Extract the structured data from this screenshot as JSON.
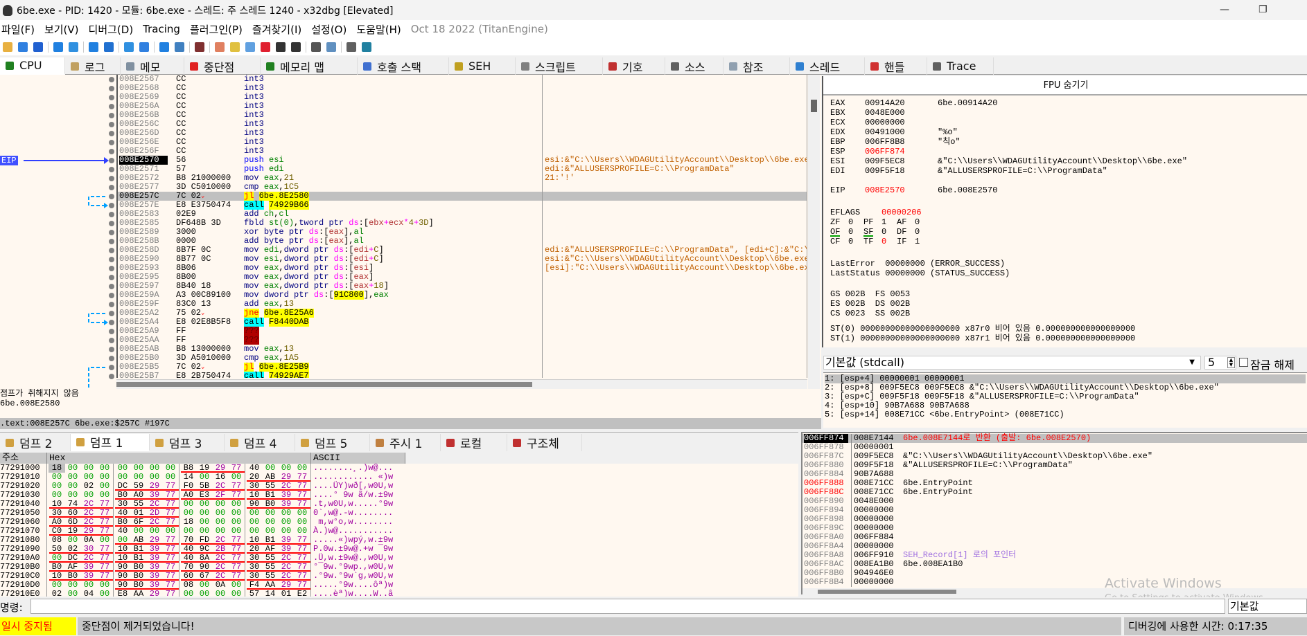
{
  "window": {
    "title": "6be.exe - PID: 1420 - 모듈: 6be.exe - 스레드: 주 스레드 1240 - x32dbg [Elevated]",
    "minimize": "—",
    "restore": "❐"
  },
  "menu": [
    "파일(F)",
    "보기(V)",
    "디버그(D)",
    "Tracing",
    "플러그인(P)",
    "즐겨찾기(I)",
    "설정(O)",
    "도움말(H)"
  ],
  "version": "Oct 18 2022 (TitanEngine)",
  "toolbar": [
    {
      "icon": "open-icon",
      "color": "#e8b040"
    },
    {
      "icon": "restart-icon",
      "color": "#3080e0"
    },
    {
      "icon": "stop-icon",
      "color": "#2060d0"
    },
    "sep",
    {
      "icon": "run-icon",
      "color": "#2080e0"
    },
    {
      "icon": "pause-icon",
      "color": "#3090e0"
    },
    "sep",
    {
      "icon": "step-into-icon",
      "color": "#2080e0"
    },
    {
      "icon": "step-over-icon",
      "color": "#2070d0"
    },
    "sep",
    {
      "icon": "trace-into-icon",
      "color": "#3090e0"
    },
    {
      "icon": "trace-over-icon",
      "color": "#3080e0"
    },
    "sep",
    {
      "icon": "execute-till-return-icon",
      "color": "#2080e0"
    },
    {
      "icon": "run-to-user-code-icon",
      "color": "#4080c0"
    },
    "sep",
    {
      "icon": "scylla-icon",
      "color": "#803030"
    },
    "sep",
    {
      "icon": "patch-icon",
      "color": "#e08060"
    },
    {
      "icon": "comments-icon",
      "color": "#e0c040"
    },
    {
      "icon": "labels-icon",
      "color": "#60a0e0"
    },
    {
      "icon": "bookmarks-icon",
      "color": "#e02030"
    },
    {
      "icon": "functions-icon",
      "color": "#333333"
    },
    {
      "icon": "hash-icon",
      "color": "#333333"
    },
    "sep",
    {
      "icon": "font-icon",
      "color": "#555555"
    },
    {
      "icon": "phone-icon",
      "color": "#6090c0"
    },
    "sep",
    {
      "icon": "calculator-icon",
      "color": "#606060"
    },
    {
      "icon": "globe-icon",
      "color": "#2080a0"
    }
  ],
  "tabs": [
    {
      "label": "CPU",
      "icon": "cpu-icon",
      "color": "#208020",
      "active": true
    },
    {
      "label": "로그",
      "icon": "log-icon",
      "color": "#c0a060"
    },
    {
      "label": "메모",
      "icon": "notes-icon",
      "color": "#8090a0"
    },
    {
      "label": "중단점",
      "icon": "breakpoint-icon",
      "color": "#e02020"
    },
    {
      "label": "메모리 맵",
      "icon": "memory-map-icon",
      "color": "#208020"
    },
    {
      "label": "호출 스택",
      "icon": "call-stack-icon",
      "color": "#4070d0"
    },
    {
      "label": "SEH",
      "icon": "seh-icon",
      "color": "#c0a020"
    },
    {
      "label": "스크립트",
      "icon": "script-icon",
      "color": "#808080"
    },
    {
      "label": "기호",
      "icon": "symbols-icon",
      "color": "#c03030"
    },
    {
      "label": "소스",
      "icon": "source-icon",
      "color": "#606060"
    },
    {
      "label": "참조",
      "icon": "references-icon",
      "color": "#90a0b0"
    },
    {
      "label": "스레드",
      "icon": "threads-icon",
      "color": "#3080d0"
    },
    {
      "label": "핸들",
      "icon": "handles-icon",
      "color": "#d03030"
    },
    {
      "label": "Trace",
      "icon": "trace-icon",
      "color": "#606060"
    }
  ],
  "disasm": {
    "eip_label": "EIP",
    "rows": [
      {
        "addr": "008E2567",
        "bytes": "CC",
        "ins": "int3"
      },
      {
        "addr": "008E2568",
        "bytes": "CC",
        "ins": "int3"
      },
      {
        "addr": "008E2569",
        "bytes": "CC",
        "ins": "int3"
      },
      {
        "addr": "008E256A",
        "bytes": "CC",
        "ins": "int3"
      },
      {
        "addr": "008E256B",
        "bytes": "CC",
        "ins": "int3"
      },
      {
        "addr": "008E256C",
        "bytes": "CC",
        "ins": "int3"
      },
      {
        "addr": "008E256D",
        "bytes": "CC",
        "ins": "int3"
      },
      {
        "addr": "008E256E",
        "bytes": "CC",
        "ins": "int3"
      },
      {
        "addr": "008E256F",
        "bytes": "CC",
        "ins": "int3"
      },
      {
        "addr": "008E2570",
        "bytes": "56",
        "ins": "push esi",
        "comment": "esi:&\"C:\\\\Users\\\\WDAGUtilityAccount\\\\Desktop\\\\6be.exe\"",
        "eip": true
      },
      {
        "addr": "008E2571",
        "bytes": "57",
        "ins": "push edi",
        "comment": "edi:&\"ALLUSERSPROFILE=C:\\\\ProgramData\""
      },
      {
        "addr": "008E2572",
        "bytes": "B8 21000000",
        "ins": "mov eax,21",
        "comment": "21:'!'"
      },
      {
        "addr": "008E2577",
        "bytes": "3D C5010000",
        "ins": "cmp eax,1C5"
      },
      {
        "addr": "008E257C",
        "bytes": "7C 02",
        "ins": "jl 6be.8E2580",
        "selected": true,
        "jump": true
      },
      {
        "addr": "008E257E",
        "bytes": "E8 E3750474",
        "ins": "call 74929B66"
      },
      {
        "addr": "008E2583",
        "bytes": "02E9",
        "ins": "add ch,cl"
      },
      {
        "addr": "008E2585",
        "bytes": "DF648B 3D",
        "ins": "fbld st(0),tword ptr ds:[ebx+ecx*4+3D]"
      },
      {
        "addr": "008E2589",
        "bytes": "3000",
        "ins": "xor byte ptr ds:[eax],al"
      },
      {
        "addr": "008E258B",
        "bytes": "0000",
        "ins": "add byte ptr ds:[eax],al"
      },
      {
        "addr": "008E258D",
        "bytes": "8B7F 0C",
        "ins": "mov edi,dword ptr ds:[edi+C]",
        "comment": "edi:&\"ALLUSERSPROFILE=C:\\\\ProgramData\", [edi+C]:&\"C:\\\\Users\\\\WDAGUtilityAccount\\\\Desktop\\\\6be.exe\""
      },
      {
        "addr": "008E2590",
        "bytes": "8B77 0C",
        "ins": "mov esi,dword ptr ds:[edi+C]",
        "comment": "esi:&\"C:\\\\Users\\\\WDAGUtilityAccount\\\\Desktop\\\\6be.exe\""
      },
      {
        "addr": "008E2593",
        "bytes": "8B06",
        "ins": "mov eax,dword ptr ds:[esi]",
        "comment": "[esi]:\"C:\\\\Users\\\\WDAGUtilityAccount\\\\Desktop\\\\6be.exe\""
      },
      {
        "addr": "008E2595",
        "bytes": "8B00",
        "ins": "mov eax,dword ptr ds:[eax]"
      },
      {
        "addr": "008E2597",
        "bytes": "8B40 18",
        "ins": "mov eax,dword ptr ds:[eax+18]"
      },
      {
        "addr": "008E259A",
        "bytes": "A3 00C89100",
        "ins": "mov dword ptr ds:[91C800],eax"
      },
      {
        "addr": "008E259F",
        "bytes": "83C0 13",
        "ins": "add eax,13"
      },
      {
        "addr": "008E25A2",
        "bytes": "75 02",
        "ins": "jne 6be.8E25A6",
        "jump": true
      },
      {
        "addr": "008E25A4",
        "bytes": "E8 02E8B5F8",
        "ins": "call F8440DAB"
      },
      {
        "addr": "008E25A9",
        "bytes": "FF",
        "ins": "???"
      },
      {
        "addr": "008E25AA",
        "bytes": "FF",
        "ins": "???"
      },
      {
        "addr": "008E25AB",
        "bytes": "B8 13000000",
        "ins": "mov eax,13"
      },
      {
        "addr": "008E25B0",
        "bytes": "3D A5010000",
        "ins": "cmp eax,1A5"
      },
      {
        "addr": "008E25B5",
        "bytes": "7C 02",
        "ins": "jl 6be.8E25B9",
        "jump": true
      },
      {
        "addr": "008E25B7",
        "bytes": "E8 2B750474",
        "ins": "call 74929AE7"
      }
    ]
  },
  "info": {
    "line1": "점프가 취해지지 않음",
    "line2": "6be.008E2580",
    "address_line": ".text:008E257C 6be.exe:$257C #197C"
  },
  "registers": {
    "fpu_toggle": "FPU 숨기기",
    "gpr": [
      {
        "name": "EAX",
        "value": "00914A20",
        "info": "6be.00914A20"
      },
      {
        "name": "EBX",
        "value": "0048E000",
        "info": ""
      },
      {
        "name": "ECX",
        "value": "00000000",
        "info": ""
      },
      {
        "name": "EDX",
        "value": "00491000",
        "info": "\"%o\""
      },
      {
        "name": "EBP",
        "value": "006FF8B8",
        "info": "\"칙o\""
      },
      {
        "name": "ESP",
        "value": "006FF874",
        "info": "",
        "changed": true
      },
      {
        "name": "ESI",
        "value": "009F5EC8",
        "info": "&\"C:\\\\Users\\\\WDAGUtilityAccount\\\\Desktop\\\\6be.exe\""
      },
      {
        "name": "EDI",
        "value": "009F5F18",
        "info": "&\"ALLUSERSPROFILE=C:\\\\ProgramData\""
      }
    ],
    "eip": {
      "name": "EIP",
      "value": "008E2570",
      "info": "6be.008E2570"
    },
    "eflags": {
      "name": "EFLAGS",
      "value": "00000206"
    },
    "flags": [
      [
        "ZF",
        "0"
      ],
      [
        "PF",
        "1"
      ],
      [
        "AF",
        "0"
      ],
      [
        "OF",
        "0"
      ],
      [
        "SF",
        "0"
      ],
      [
        "DF",
        "0"
      ],
      [
        "CF",
        "0"
      ],
      [
        "TF",
        "0"
      ],
      [
        "IF",
        "1"
      ]
    ],
    "last_error": "LastError  00000000 (ERROR_SUCCESS)",
    "last_status": "LastStatus 00000000 (STATUS_SUCCESS)",
    "segments": [
      "GS 002B  FS 0053",
      "ES 002B  DS 002B",
      "CS 0023  SS 002B"
    ],
    "fpu": [
      "ST(0) 00000000000000000000 x87r0 비어 있음 0.000000000000000000",
      "ST(1) 00000000000000000000 x87r1 비어 있음 0.000000000000000000"
    ]
  },
  "callconv": {
    "selected": "기본값 (stdcall)",
    "count": "5",
    "lock_label": "잠금 해제"
  },
  "args": [
    "1: [esp+4] 00000001 00000001",
    "2: [esp+8] 009F5EC8 009F5EC8 &\"C:\\\\Users\\\\WDAGUtilityAccount\\\\Desktop\\\\6be.exe\"",
    "3: [esp+C] 009F5F18 009F5F18 &\"ALLUSERSPROFILE=C:\\\\ProgramData\"",
    "4: [esp+10] 90B7A688 90B7A688",
    "5: [esp+14] 008E71CC <6be.EntryPoint> (008E71CC)"
  ],
  "bottom_tabs": [
    {
      "label": "덤프 2",
      "icon": "dump-icon"
    },
    {
      "label": "덤프 1",
      "icon": "dump-icon",
      "active": true
    },
    {
      "label": "덤프 3",
      "icon": "dump-icon"
    },
    {
      "label": "덤프 4",
      "icon": "dump-icon"
    },
    {
      "label": "덤프 5",
      "icon": "dump-icon"
    },
    {
      "label": "주시 1",
      "icon": "watch-icon"
    },
    {
      "label": "로컬",
      "icon": "locals-icon"
    },
    {
      "label": "구조체",
      "icon": "struct-icon"
    }
  ],
  "dump": {
    "headers": {
      "addr": "주소",
      "hex": "Hex",
      "ascii": "ASCII"
    },
    "rows": [
      {
        "addr": "77291000",
        "hex": "18 00 00 00 00 00 00 00 B8 19 29 77 40 00 00 00",
        "ascii": "........¸.)w@..."
      },
      {
        "addr": "77291010",
        "hex": "00 00 00 00 00 00 00 00 14 00 16 00 20 AB 29 77",
        "ascii": "............ «)w"
      },
      {
        "addr": "77291020",
        "hex": "00 00 02 00 DC 59 29 77 F0 5B 2C 77 30 55 2C 77",
        "ascii": "....ÜY)wð[,w0U,w"
      },
      {
        "addr": "77291030",
        "hex": "00 00 00 00 B0 A0 39 77 A0 E3 2F 77 10 B1 39 77",
        "ascii": "....° 9w ã/w.±9w"
      },
      {
        "addr": "77291040",
        "hex": "10 74 2C 77 30 55 2C 77 00 00 00 00 90 B0 39 77",
        "ascii": ".t,w0U,w.....°9w"
      },
      {
        "addr": "77291050",
        "hex": "30 60 2C 77 40 01 2D 77 00 00 00 00 00 00 00 00",
        "ascii": "0`,w@.-w........"
      },
      {
        "addr": "77291060",
        "hex": "A0 6D 2C 77 B0 6F 2C 77 18 00 00 00 00 00 00 00",
        "ascii": " m,w°o,w........"
      },
      {
        "addr": "77291070",
        "hex": "C0 19 29 77 40 00 00 00 00 00 00 00 00 00 00 00",
        "ascii": "À.)w@..........."
      },
      {
        "addr": "77291080",
        "hex": "08 00 0A 00 00 AB 29 77 70 FD 2C 77 10 B1 39 77",
        "ascii": ".....«)wpý,w.±9w"
      },
      {
        "addr": "77291090",
        "hex": "50 02 30 77 10 B1 39 77 40 9C 2B 77 20 AF 39 77",
        "ascii": "P.0w.±9w@.+w ¯9w"
      },
      {
        "addr": "772910A0",
        "hex": "00 DC 2C 77 10 B1 39 77 40 8A 2C 77 30 55 2C 77",
        "ascii": ".Ü,w.±9w@.,w0U,w"
      },
      {
        "addr": "772910B0",
        "hex": "B0 AF 39 77 90 B0 39 77 70 90 2C 77 30 55 2C 77",
        "ascii": "°¯9w.°9wp.,w0U,w"
      },
      {
        "addr": "772910C0",
        "hex": "10 B0 39 77 90 B0 39 77 60 67 2C 77 30 55 2C 77",
        "ascii": ".°9w.°9w`g,w0U,w"
      },
      {
        "addr": "772910D0",
        "hex": "00 00 00 00 90 B0 39 77 08 00 0A 00 F4 AA 29 77",
        "ascii": ".....°9w....ôª)w"
      },
      {
        "addr": "772910E0",
        "hex": "02 00 04 00 E8 AA 29 77 00 00 00 00 57 14 01 E2",
        "ascii": "....èª)w....W..â"
      }
    ]
  },
  "stack": [
    {
      "addr": "006FF874",
      "value": "008E7144",
      "comment": "6be.008E7144로 반환 (출발: 6be.008E2570)",
      "top": true
    },
    {
      "addr": "006FF878",
      "value": "00000001",
      "comment": ""
    },
    {
      "addr": "006FF87C",
      "value": "009F5EC8",
      "comment": "&\"C:\\\\Users\\\\WDAGUtilityAccount\\\\Desktop\\\\6be.exe\""
    },
    {
      "addr": "006FF880",
      "value": "009F5F18",
      "comment": "&\"ALLUSERSPROFILE=C:\\\\ProgramData\""
    },
    {
      "addr": "006FF884",
      "value": "90B7A688",
      "comment": ""
    },
    {
      "addr": "006FF888",
      "value": "008E71CC",
      "comment": "6be.EntryPoint",
      "red": true
    },
    {
      "addr": "006FF88C",
      "value": "008E71CC",
      "comment": "6be.EntryPoint",
      "red": true
    },
    {
      "addr": "006FF890",
      "value": "0048E000",
      "comment": ""
    },
    {
      "addr": "006FF894",
      "value": "00000000",
      "comment": ""
    },
    {
      "addr": "006FF898",
      "value": "00000000",
      "comment": ""
    },
    {
      "addr": "006FF89C",
      "value": "00000000",
      "comment": ""
    },
    {
      "addr": "006FF8A0",
      "value": "006FF884",
      "comment": ""
    },
    {
      "addr": "006FF8A4",
      "value": "00000000",
      "comment": ""
    },
    {
      "addr": "006FF8A8",
      "value": "006FF910",
      "comment": "SEH_Record[1] 로의 포인터",
      "seh": true
    },
    {
      "addr": "006FF8AC",
      "value": "008EA1B0",
      "comment": "6be.008EA1B0"
    },
    {
      "addr": "006FF8B0",
      "value": "904946E0",
      "comment": ""
    },
    {
      "addr": "006FF8B4",
      "value": "00000000",
      "comment": ""
    }
  ],
  "command": {
    "label": "명령:",
    "value": "",
    "default_label": "기본값"
  },
  "status": {
    "state": "일시 중지됨",
    "message": "중단점이 제거되었습니다!",
    "time": "디버깅에 사용한 시간: 0:17:35"
  },
  "watermark": {
    "line1": "Activate Windows",
    "line2": "Go to Settings to activate Windows."
  }
}
